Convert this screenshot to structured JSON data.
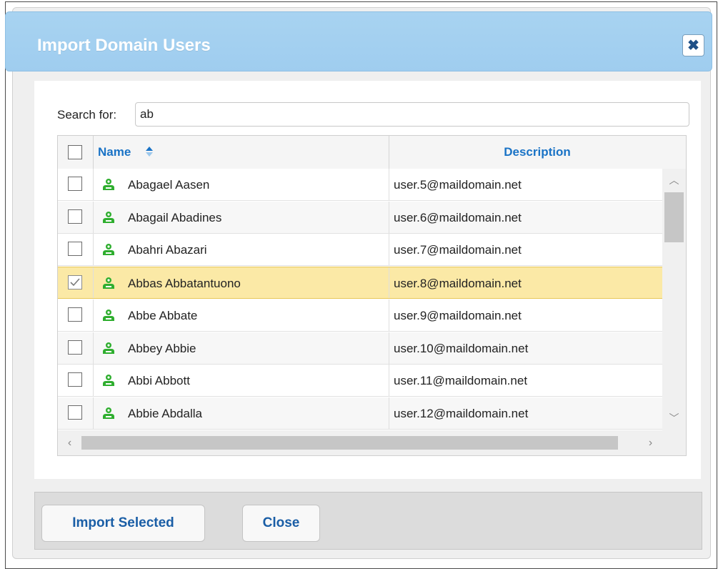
{
  "dialog": {
    "title": "Import Domain Users",
    "close_icon": "close-icon"
  },
  "search": {
    "label": "Search for:",
    "value": "ab"
  },
  "grid": {
    "columns": [
      {
        "label": "Name",
        "sort": "ascending"
      },
      {
        "label": "Description"
      }
    ],
    "rows": [
      {
        "name": "Abagael Aasen",
        "description": "user.5@maildomain.net",
        "checked": false
      },
      {
        "name": "Abagail Abadines",
        "description": "user.6@maildomain.net",
        "checked": false
      },
      {
        "name": "Abahri Abazari",
        "description": "user.7@maildomain.net",
        "checked": false
      },
      {
        "name": "Abbas Abbatantuono",
        "description": "user.8@maildomain.net",
        "checked": true
      },
      {
        "name": "Abbe Abbate",
        "description": "user.9@maildomain.net",
        "checked": false
      },
      {
        "name": "Abbey Abbie",
        "description": "user.10@maildomain.net",
        "checked": false
      },
      {
        "name": "Abbi Abbott",
        "description": "user.11@maildomain.net",
        "checked": false
      },
      {
        "name": "Abbie Abdalla",
        "description": "user.12@maildomain.net",
        "checked": false
      }
    ]
  },
  "footer": {
    "import_label": "Import Selected",
    "close_label": "Close"
  },
  "colors": {
    "titlebar": "#a8d3f1",
    "accent_link": "#1a73c6",
    "selected_row": "#fbe9a6",
    "user_icon": "#2fae2f"
  }
}
